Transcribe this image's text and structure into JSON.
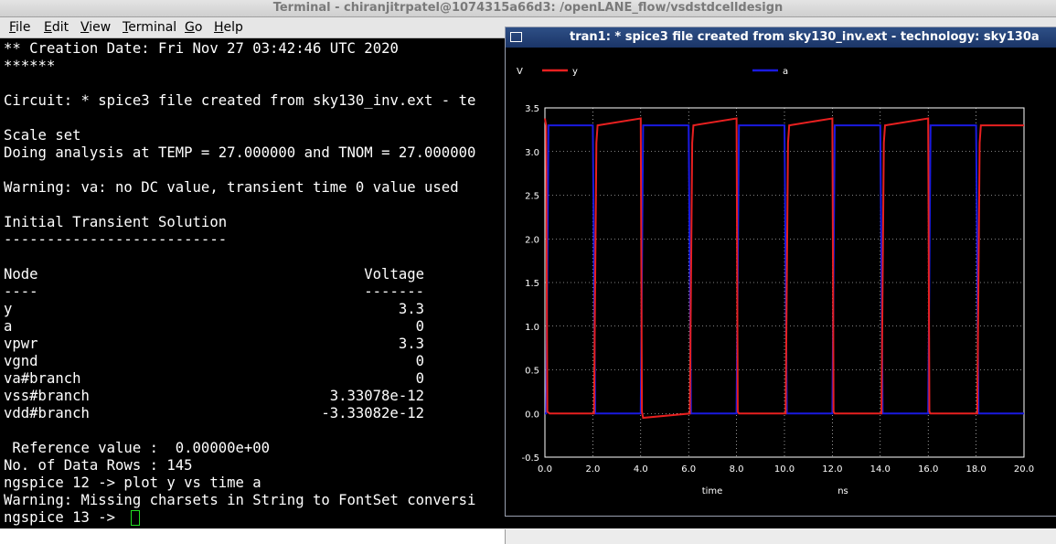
{
  "terminal": {
    "title": "Terminal - chiranjitrpatel@1074315a66d3: /openLANE_flow/vsdstdcelldesign",
    "menu": [
      {
        "first": "F",
        "rest": "ile"
      },
      {
        "first": "E",
        "rest": "dit"
      },
      {
        "first": "V",
        "rest": "iew"
      },
      {
        "first": "T",
        "rest": "erminal"
      },
      {
        "first": "G",
        "rest": "o"
      },
      {
        "first": "H",
        "rest": "elp"
      }
    ],
    "lines": {
      "creation": "** Creation Date: Fri Nov 27 03:42:46 UTC 2020",
      "stars": "******",
      "circuit": "Circuit: * spice3 file created from sky130_inv.ext - te",
      "scale": "Scale set",
      "doing": "Doing analysis at TEMP = 27.000000 and TNOM = 27.000000",
      "warning1": "Warning: va: no DC value, transient time 0 value used",
      "initial": "Initial Transient Solution",
      "dashes": "--------------------------",
      "node_header": "Node",
      "voltage_header": "Voltage",
      "node_dashes": "----",
      "voltage_dashes": "-------",
      "reference": " Reference value :  0.00000e+00",
      "datarows": "No. of Data Rows : 145",
      "plotcmd": "ngspice 12 -> plot y vs time a",
      "warning2": "Warning: Missing charsets in String to FontSet conversi",
      "prompt": "ngspice 13 -> "
    },
    "nodes": [
      {
        "name": "y",
        "value": "3.3"
      },
      {
        "name": "a",
        "value": "0"
      },
      {
        "name": "vpwr",
        "value": "3.3"
      },
      {
        "name": "vgnd",
        "value": "0"
      },
      {
        "name": "va#branch",
        "value": "0"
      },
      {
        "name": "vss#branch",
        "value": "3.33078e-12"
      },
      {
        "name": "vdd#branch",
        "value": "-3.33082e-12"
      }
    ]
  },
  "plot_window": {
    "title": "tran1: * spice3 file created from sky130_inv.ext - technology: sky130a"
  },
  "chart_data": {
    "type": "line",
    "ylabel": "V",
    "xlabel": "time",
    "xunit": "ns",
    "xlim": [
      0,
      20
    ],
    "ylim": [
      -0.5,
      3.5
    ],
    "xticks": [
      "0.0",
      "2.0",
      "4.0",
      "6.0",
      "8.0",
      "10.0",
      "12.0",
      "14.0",
      "16.0",
      "18.0",
      "20.0"
    ],
    "yticks": [
      "3.5",
      "3.0",
      "2.5",
      "2.0",
      "1.5",
      "1.0",
      "0.5",
      "0.0",
      "-0.5"
    ],
    "grid": true,
    "legend_position": "top",
    "series": [
      {
        "name": "y",
        "color": "#e82020",
        "x": [
          0,
          0.05,
          0.1,
          0.2,
          2.05,
          2.15,
          2.2,
          4.0,
          4.05,
          4.1,
          6.05,
          6.15,
          6.2,
          8.0,
          8.05,
          8.1,
          10.05,
          10.15,
          10.2,
          12.0,
          12.05,
          12.1,
          14.05,
          14.15,
          14.2,
          16.0,
          16.05,
          16.1,
          18.05,
          18.15,
          18.2,
          20.0
        ],
        "values": [
          3.38,
          3.3,
          0.02,
          0.0,
          0.0,
          3.1,
          3.3,
          3.38,
          0.02,
          -0.05,
          0.0,
          3.1,
          3.3,
          3.38,
          0.02,
          0.0,
          0.0,
          3.1,
          3.3,
          3.38,
          0.02,
          0.0,
          0.0,
          3.1,
          3.3,
          3.38,
          0.02,
          0.0,
          0.0,
          3.1,
          3.3,
          3.3
        ]
      },
      {
        "name": "a",
        "color": "#1a1ae0",
        "x": [
          0,
          0.05,
          0.15,
          2.0,
          2.1,
          4.0,
          4.1,
          6.0,
          6.1,
          8.0,
          8.1,
          10.0,
          10.1,
          12.0,
          12.1,
          14.0,
          14.1,
          16.0,
          16.1,
          18.0,
          18.1,
          20.0
        ],
        "values": [
          0.0,
          0.0,
          3.3,
          3.3,
          0.0,
          0.0,
          3.3,
          3.3,
          0.0,
          0.0,
          3.3,
          3.3,
          0.0,
          0.0,
          3.3,
          3.3,
          0.0,
          0.0,
          3.3,
          3.3,
          0.0,
          0.0
        ]
      }
    ]
  }
}
